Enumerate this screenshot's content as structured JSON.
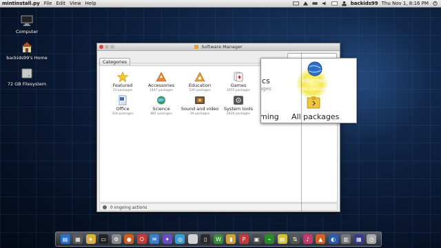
{
  "top_panel": {
    "app_title": "mintinstall.py",
    "menu": [
      "File",
      "Edit",
      "View",
      "Help"
    ],
    "username": "backids99",
    "datetime": "Thu Nov 1, 8:16 PM"
  },
  "desktop": {
    "icons": [
      {
        "label": "Computer",
        "icon": "computer-icon"
      },
      {
        "label": "backids99's Home",
        "icon": "home-icon"
      },
      {
        "label": "72 GB Filesystem",
        "icon": "drive-icon"
      }
    ]
  },
  "window": {
    "title": "Software Manager",
    "toolbar": {
      "categories_label": "Categories"
    },
    "categories": [
      {
        "name": "Featured",
        "count": "33 packages",
        "icon": "star-icon"
      },
      {
        "name": "Accessories",
        "count": "1447 packages",
        "icon": "accessories-icon"
      },
      {
        "name": "Education",
        "count": "539 packages",
        "icon": "education-icon"
      },
      {
        "name": "Games",
        "count": "1055 packages",
        "icon": "games-icon"
      },
      {
        "name": "Office",
        "count": "318 packages",
        "icon": "office-icon"
      },
      {
        "name": "Science",
        "count": "881 packages",
        "icon": "science-icon"
      },
      {
        "name": "Sound and video",
        "count": "39 packages",
        "icon": "sound-video-icon"
      },
      {
        "name": "System tools",
        "count": "2826 packages",
        "icon": "system-tools-icon"
      }
    ],
    "status": "0 ongoing actions"
  },
  "zoom_overlay": {
    "fragments": [
      "ics",
      "ages",
      "ming"
    ],
    "internet_label": "Internet",
    "internet_count": "486 packages",
    "all_packages_label": "All packages"
  },
  "colors": {
    "accent_orange": "#e7a23a",
    "desktop_blue": "#0e213f"
  }
}
